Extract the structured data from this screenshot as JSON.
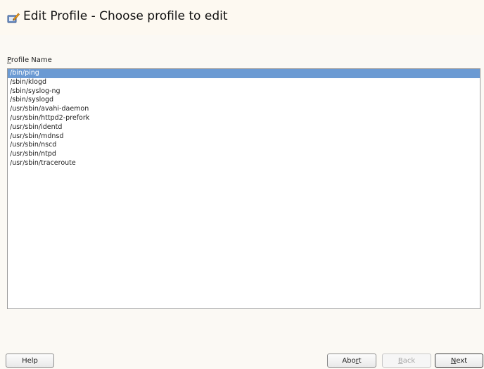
{
  "header": {
    "title": "Edit Profile - Choose profile to edit",
    "icon": "edit-profile-icon"
  },
  "profile_list": {
    "label_mnemonic": "P",
    "label_rest": "rofile Name",
    "items": [
      "/bin/ping",
      "/sbin/klogd",
      "/sbin/syslog-ng",
      "/sbin/syslogd",
      "/usr/sbin/avahi-daemon",
      "/usr/sbin/httpd2-prefork",
      "/usr/sbin/identd",
      "/usr/sbin/mdnsd",
      "/usr/sbin/nscd",
      "/usr/sbin/ntpd",
      "/usr/sbin/traceroute"
    ],
    "selected_index": 0
  },
  "buttons": {
    "help": {
      "label": "Help"
    },
    "abort": {
      "pre": "Abo",
      "mnemonic": "r",
      "post": "t"
    },
    "back": {
      "pre": "",
      "mnemonic": "B",
      "post": "ack",
      "disabled": true
    },
    "next": {
      "pre": "",
      "mnemonic": "N",
      "post": "ext"
    }
  },
  "colors": {
    "selection": "#6b9ad3",
    "background": "#fbf9f4"
  }
}
